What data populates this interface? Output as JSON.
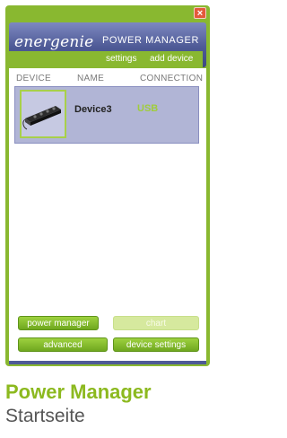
{
  "window": {
    "close_label": "×",
    "brand": "energenie",
    "title": "POWER MANAGER",
    "nav": {
      "settings": "settings",
      "add_device": "add device"
    }
  },
  "table": {
    "columns": [
      "DEVICE",
      "NAME",
      "CONNECTION"
    ],
    "rows": [
      {
        "name": "Device3",
        "connection": "USB"
      }
    ]
  },
  "buttons": {
    "power_manager": "power manager",
    "chart": "chart",
    "advanced": "advanced",
    "device_settings": "device settings"
  },
  "caption": {
    "title": "Power Manager",
    "subtitle": "Startseite"
  },
  "colors": {
    "accent_green": "#89b830",
    "header_blue": "#4e5a96",
    "selection": "#b1b5d6"
  }
}
